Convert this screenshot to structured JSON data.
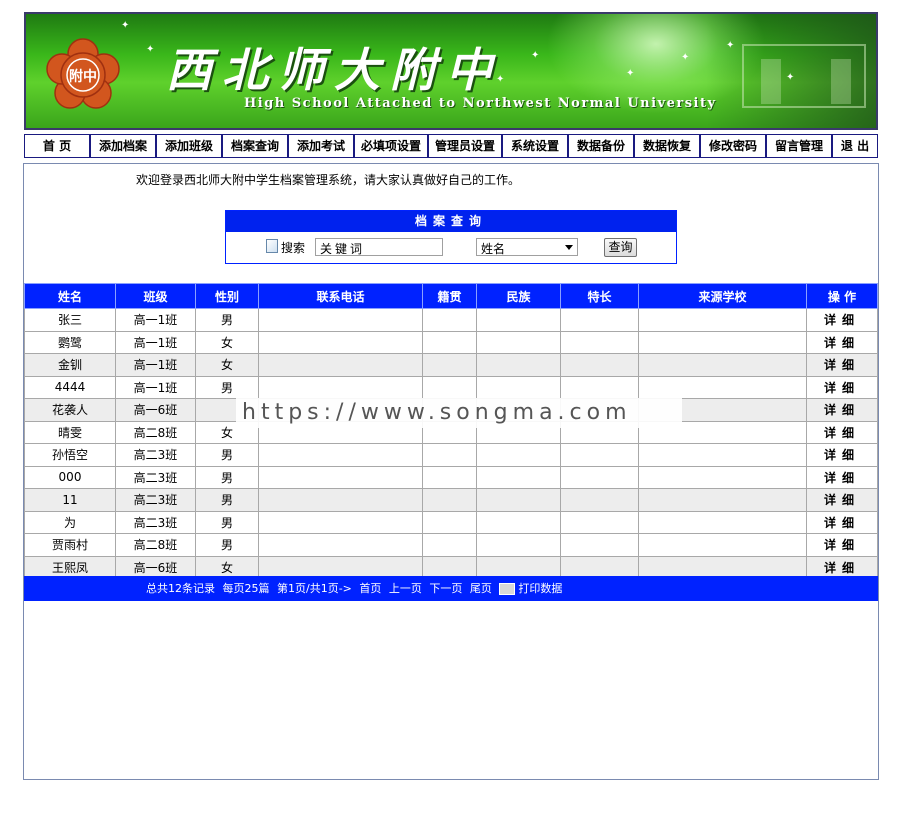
{
  "banner": {
    "school_name_cn": "西北师大附中",
    "school_name_en": "High School Attached to Northwest Normal University",
    "logo_text": "附中"
  },
  "nav": {
    "items": [
      {
        "label": "首 页"
      },
      {
        "label": "添加档案"
      },
      {
        "label": "添加班级"
      },
      {
        "label": "档案查询"
      },
      {
        "label": "添加考试"
      },
      {
        "label": "必填项设置"
      },
      {
        "label": "管理员设置"
      },
      {
        "label": "系统设置"
      },
      {
        "label": "数据备份"
      },
      {
        "label": "数据恢复"
      },
      {
        "label": "修改密码"
      },
      {
        "label": "留言管理"
      },
      {
        "label": "退 出"
      }
    ]
  },
  "welcome": "欢迎登录西北师大附中学生档案管理系统，请大家认真做好自己的工作。",
  "search": {
    "title": "档案查询",
    "label": "搜索",
    "keyword_value": "关键词",
    "field_selected": "姓名",
    "submit_label": "查询"
  },
  "table": {
    "columns": [
      "姓名",
      "班级",
      "性别",
      "联系电话",
      "籍贯",
      "民族",
      "特长",
      "来源学校",
      "操 作"
    ],
    "rows": [
      {
        "name": "张三",
        "class": "高一1班",
        "gender": "男",
        "action": "详细"
      },
      {
        "name": "鹦鹭",
        "class": "高一1班",
        "gender": "女",
        "action": "详细"
      },
      {
        "name": "金钏",
        "class": "高一1班",
        "gender": "女",
        "action": "详细"
      },
      {
        "name": "4444",
        "class": "高一1班",
        "gender": "男",
        "action": "详细"
      },
      {
        "name": "花袭人",
        "class": "高一6班",
        "gender": "",
        "action": "详细"
      },
      {
        "name": "晴雯",
        "class": "高二8班",
        "gender": "女",
        "action": "详细"
      },
      {
        "name": "孙悟空",
        "class": "高二3班",
        "gender": "男",
        "action": "详细"
      },
      {
        "name": "000",
        "class": "高二3班",
        "gender": "男",
        "action": "详细"
      },
      {
        "name": "11",
        "class": "高二3班",
        "gender": "男",
        "action": "详细"
      },
      {
        "name": "为",
        "class": "高二3班",
        "gender": "男",
        "action": "详细"
      },
      {
        "name": "贾雨村",
        "class": "高二8班",
        "gender": "男",
        "action": "详细"
      },
      {
        "name": "王熙凤",
        "class": "高一6班",
        "gender": "女",
        "action": "详细"
      }
    ]
  },
  "pagination": {
    "total_text": "总共12条记录",
    "per_page_text": "每页25篇",
    "page_text": "第1页/共1页->",
    "first": "首页",
    "prev": "上一页",
    "next": "下一页",
    "last": "尾页",
    "print": "打印数据"
  },
  "watermark": "https://www.songma.com",
  "colors": {
    "nav_border": "#1a1a80",
    "header_blue": "#0022ff",
    "banner_green": "#39b61a"
  }
}
